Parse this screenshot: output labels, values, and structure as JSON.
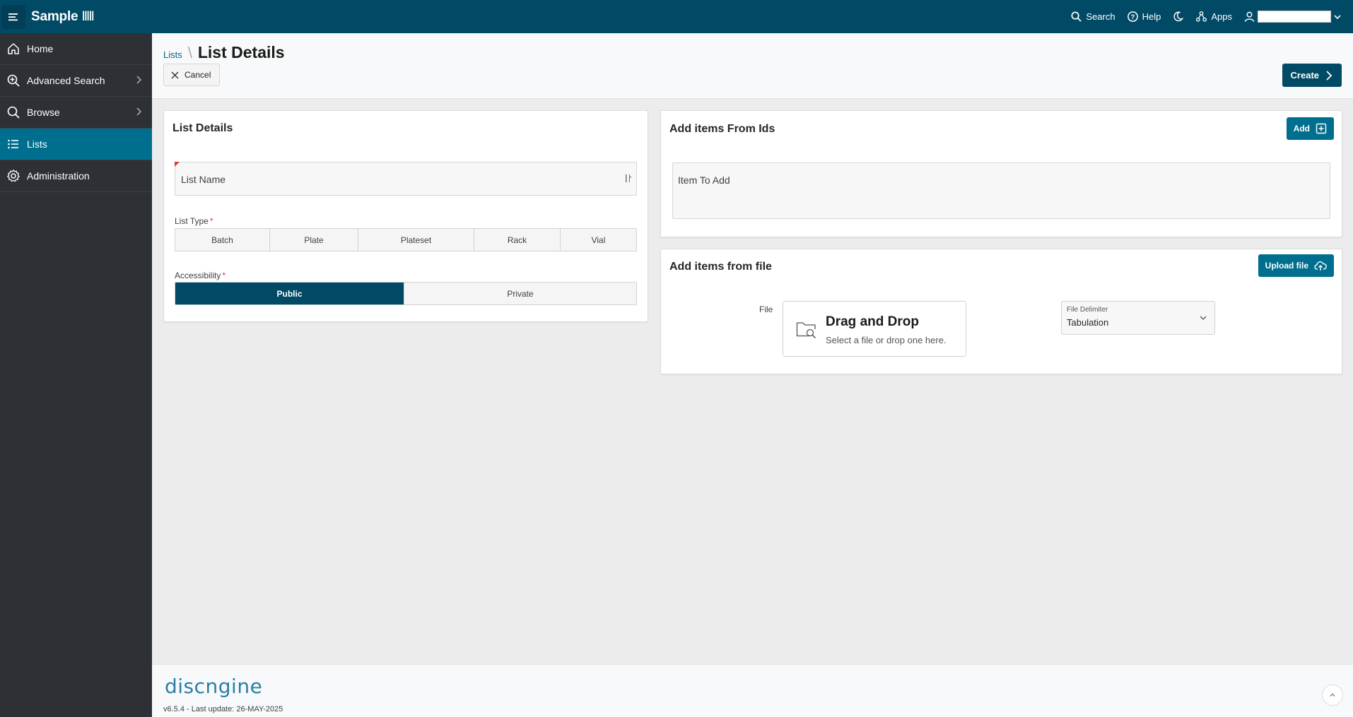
{
  "app": {
    "title": "Sample",
    "title_barcode": "IIIII"
  },
  "topbar": {
    "search_label": "Search",
    "help_label": "Help",
    "apps_label": "Apps",
    "menu_icon": "hamburger-icon",
    "theme_icon": "moon-icon"
  },
  "sidebar": {
    "items": [
      {
        "label": "Home",
        "icon": "home-icon",
        "active": false,
        "has_submenu": false
      },
      {
        "label": "Advanced Search",
        "icon": "zoom-plus-icon",
        "active": false,
        "has_submenu": true
      },
      {
        "label": "Browse",
        "icon": "search-icon",
        "active": false,
        "has_submenu": true
      },
      {
        "label": "Lists",
        "icon": "list-icon",
        "active": true,
        "has_submenu": false
      },
      {
        "label": "Administration",
        "icon": "gear-icon",
        "active": false,
        "has_submenu": false
      }
    ]
  },
  "header": {
    "breadcrumb_parent": "Lists",
    "page_title": "List Details",
    "cancel_label": "Cancel",
    "create_label": "Create"
  },
  "list_details": {
    "title": "List Details",
    "list_name_placeholder": "List Name",
    "list_type_label": "List Type",
    "list_types": [
      "Batch",
      "Plate",
      "Plateset",
      "Rack",
      "Vial"
    ],
    "accessibility_label": "Accessibility",
    "accessibility_options": [
      "Public",
      "Private"
    ],
    "accessibility_selected": "Public"
  },
  "add_from_ids": {
    "title": "Add items From Ids",
    "add_label": "Add",
    "item_placeholder": "Item To Add"
  },
  "add_from_file": {
    "title": "Add items from file",
    "upload_label": "Upload file",
    "file_label": "File",
    "dropzone_title": "Drag and Drop",
    "dropzone_subtitle": "Select a file or drop one here.",
    "delimiter_label": "File Delimiter",
    "delimiter_value": "Tabulation"
  },
  "footer": {
    "logo_text": "discngine",
    "version": "v6.5.4 - Last update: 26-MAY-2025"
  },
  "colors": {
    "primary": "#004a66",
    "accent": "#006f8f",
    "sidebar_bg": "#2d3035",
    "required": "#d63b25"
  }
}
